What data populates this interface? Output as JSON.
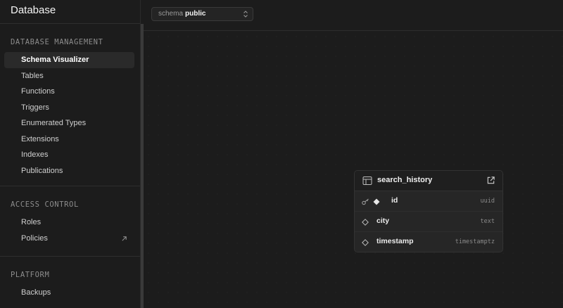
{
  "sidebar": {
    "title": "Database",
    "sections": [
      {
        "title": "DATABASE MANAGEMENT",
        "items": [
          {
            "label": "Schema Visualizer",
            "active": true
          },
          {
            "label": "Tables"
          },
          {
            "label": "Functions"
          },
          {
            "label": "Triggers"
          },
          {
            "label": "Enumerated Types"
          },
          {
            "label": "Extensions"
          },
          {
            "label": "Indexes"
          },
          {
            "label": "Publications"
          }
        ]
      },
      {
        "title": "ACCESS CONTROL",
        "items": [
          {
            "label": "Roles"
          },
          {
            "label": "Policies",
            "external_icon": "arrow-up-right-icon"
          }
        ]
      },
      {
        "title": "PLATFORM",
        "items": [
          {
            "label": "Backups"
          }
        ]
      }
    ]
  },
  "toolbar": {
    "schema_key": "schema",
    "schema_value": "public",
    "chevron_icon": "chevron-up-down-icon"
  },
  "table_node": {
    "name": "search_history",
    "header_icon": "table-icon",
    "open_icon": "external-link-icon",
    "columns": [
      {
        "name": "id",
        "type": "uuid",
        "icons": [
          "key-icon",
          "filled-diamond-icon"
        ]
      },
      {
        "name": "city",
        "type": "text",
        "icons": [
          "diamond-outline-icon"
        ]
      },
      {
        "name": "timestamp",
        "type": "timestamptz",
        "icons": [
          "diamond-outline-icon"
        ]
      }
    ]
  },
  "colors": {
    "background": "#1c1c1c",
    "panel": "#212121",
    "border": "#333333",
    "text": "#ededed",
    "muted": "#8c8c8c"
  }
}
